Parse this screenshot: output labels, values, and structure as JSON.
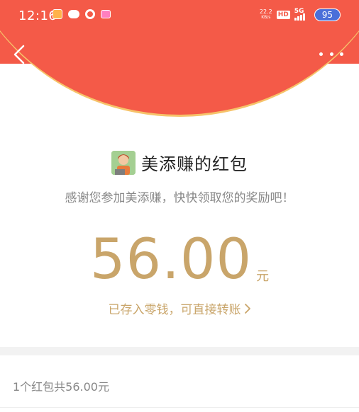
{
  "status_bar": {
    "time": "12:16",
    "net_speed_value": "22.2",
    "net_speed_unit": "KB/s",
    "hd_label": "HD",
    "network_type": "5G",
    "battery": "95"
  },
  "header": {
    "back_icon": "chevron-left-icon",
    "more_icon": "more-dots-icon",
    "background_color": "#f45a48",
    "arc_border_color": "#f6c36a"
  },
  "red_packet": {
    "sender_name": "美添赚的红包",
    "greeting": "感谢您参加美添赚，快快领取您的奖励吧！",
    "amount": "56.00",
    "amount_unit": "元",
    "amount_color": "#c9a56a",
    "transfer_text": "已存入零钱，可直接转账",
    "transfer_arrow": "›"
  },
  "summary": {
    "text": "1个红包共56.00元"
  }
}
